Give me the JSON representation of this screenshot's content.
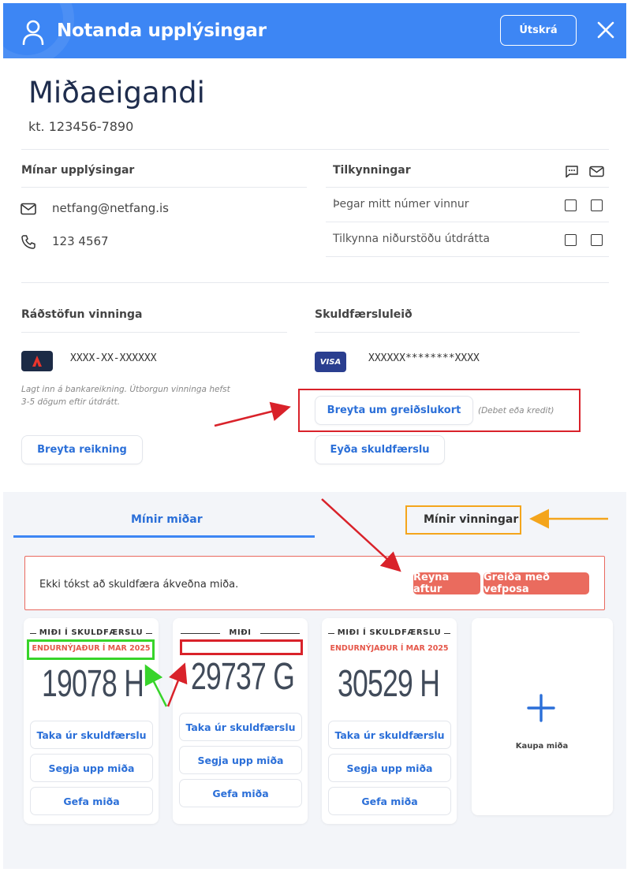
{
  "header": {
    "title": "Notanda upplýsingar",
    "logout_label": "Útskrá",
    "bg_color": "#3d86f4"
  },
  "owner": {
    "name": "Miðaeigandi",
    "kt": "kt. 123456-7890"
  },
  "my_info": {
    "title": "Mínar upplýsingar",
    "email": "netfang@netfang.is",
    "phone": "123 4567"
  },
  "notifications": {
    "title": "Tilkynningar",
    "rows": [
      {
        "label": "Þegar mitt númer vinnur",
        "sms": false,
        "email": false
      },
      {
        "label": "Tilkynna niðurstöðu útdrátta",
        "sms": false,
        "email": false
      }
    ]
  },
  "payout": {
    "title": "Ráðstöfun vinninga",
    "account_mask": "XXXX-XX-XXXXXX",
    "note": "Lagt inn á bankareikning. Útborgun vinninga hefst 3-5 dögum eftir útdrátt.",
    "change_button": "Breyta reikning"
  },
  "billing": {
    "title": "Skuldfærsluleið",
    "card_brand": "VISA",
    "card_mask": "XXXXXX********XXXX",
    "change_card_button": "Breyta um greiðslukort",
    "card_hint": "(Debet eða kredit)",
    "delete_button": "Eyða skuldfærslu"
  },
  "tabs": [
    {
      "label": "Mínir miðar",
      "active": true
    },
    {
      "label": "Mínir vinningar",
      "active": false
    }
  ],
  "error": {
    "message": "Ekki tókst að skuldfæra ákveðna miða.",
    "retry_button": "Reyna aftur",
    "pay_button": "Greiða með vefposa"
  },
  "tickets": [
    {
      "label": "MIÐI Í SKULDFÆRSLU",
      "renewal": "ENDURNÝJAÐUR Í MAR 2025",
      "number": "19078 H",
      "actions": [
        "Taka úr skuldfærslu",
        "Segja upp miða",
        "Gefa miða"
      ]
    },
    {
      "label": "MIÐI",
      "renewal": "",
      "number": "29737 G",
      "actions": [
        "Taka úr skuldfærslu",
        "Segja upp miða",
        "Gefa miða"
      ]
    },
    {
      "label": "MIÐI Í SKULDFÆRSLU",
      "renewal": "ENDURNÝJAÐUR Í MAR 2025",
      "number": "30529 H",
      "actions": [
        "Taka úr skuldfærslu",
        "Segja upp miða",
        "Gefa miða"
      ]
    }
  ],
  "buy": {
    "label": "Kaupa miða"
  },
  "colors": {
    "accent": "#3d86f4",
    "link": "#2b6fd8",
    "error": "#ea6b5e",
    "annotation_red": "#d9222a",
    "annotation_green": "#37d42a",
    "annotation_orange": "#f4a51c"
  }
}
